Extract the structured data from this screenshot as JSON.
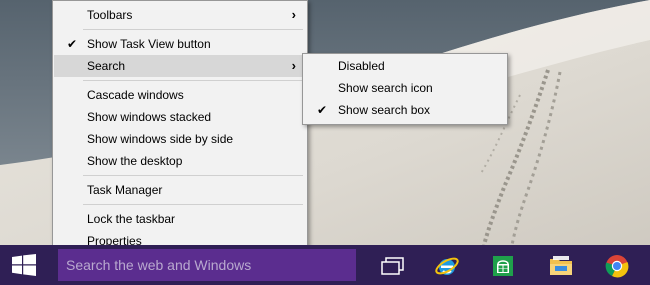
{
  "context_menu": {
    "items": [
      {
        "label": "Toolbars",
        "checked": false,
        "has_submenu": true
      },
      {
        "label": "Show Task View button",
        "checked": true,
        "has_submenu": false
      },
      {
        "label": "Search",
        "checked": false,
        "has_submenu": true,
        "highlighted": true
      },
      {
        "label": "Cascade windows",
        "checked": false,
        "has_submenu": false
      },
      {
        "label": "Show windows stacked",
        "checked": false,
        "has_submenu": false
      },
      {
        "label": "Show windows side by side",
        "checked": false,
        "has_submenu": false
      },
      {
        "label": "Show the desktop",
        "checked": false,
        "has_submenu": false
      },
      {
        "label": "Task Manager",
        "checked": false,
        "has_submenu": false
      },
      {
        "label": "Lock the taskbar",
        "checked": false,
        "has_submenu": false
      },
      {
        "label": "Properties",
        "checked": false,
        "has_submenu": false
      }
    ],
    "check_glyph": "✔",
    "arrow_glyph": "›"
  },
  "search_submenu": {
    "items": [
      {
        "label": "Disabled",
        "checked": false
      },
      {
        "label": "Show search icon",
        "checked": false
      },
      {
        "label": "Show search box",
        "checked": true
      }
    ]
  },
  "taskbar": {
    "search_placeholder": "Search the web and Windows",
    "icons": [
      "start-windows-icon",
      "task-view-icon",
      "internet-explorer-icon",
      "store-icon",
      "file-explorer-icon",
      "chrome-icon"
    ],
    "colors": {
      "taskbar": "#2f1f55",
      "search_box": "#5b2d8f",
      "placeholder": "#b9a9cf"
    }
  }
}
